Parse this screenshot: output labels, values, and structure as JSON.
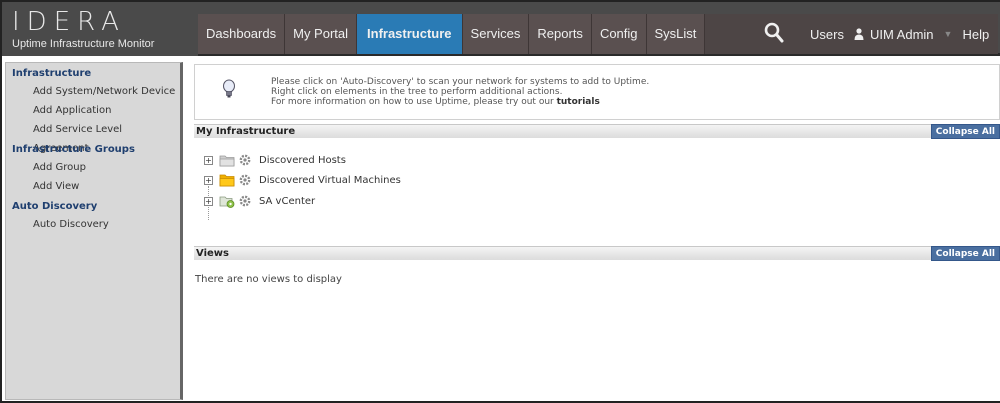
{
  "brand": {
    "logo": "IDERA",
    "subtitle": "Uptime Infrastructure Monitor"
  },
  "nav": {
    "items": [
      {
        "label": "Dashboards",
        "active": false
      },
      {
        "label": "My Portal",
        "active": false
      },
      {
        "label": "Infrastructure",
        "active": true
      },
      {
        "label": "Services",
        "active": false
      },
      {
        "label": "Reports",
        "active": false
      },
      {
        "label": "Config",
        "active": false
      },
      {
        "label": "SysList",
        "active": false
      }
    ],
    "users_label": "Users",
    "user_name": "UIM Admin",
    "help_label": "Help",
    "accent": "#2a7bb5"
  },
  "sidebar": {
    "groups": [
      {
        "title": "Infrastructure",
        "items": [
          "Add System/Network Device",
          "Add Application",
          "Add Service Level Agreement"
        ]
      },
      {
        "title": "Infrastructure Groups",
        "items": [
          "Add Group",
          "Add View"
        ]
      },
      {
        "title": "Auto Discovery",
        "items": [
          "Auto Discovery"
        ]
      }
    ]
  },
  "info": {
    "line1": "Please click on 'Auto-Discovery' to scan your network for systems to add to Uptime.",
    "line2": "Right click on elements in the tree to perform additional actions.",
    "line3_prefix": "For more information on how to use Uptime, please try out our ",
    "line3_link": "tutorials"
  },
  "infrastructure": {
    "title": "My Infrastructure",
    "collapse_label": "Collapse All",
    "tree": [
      {
        "label": "Discovered Hosts",
        "icon": "folder-grey-icon"
      },
      {
        "label": "Discovered Virtual Machines",
        "icon": "folder-yellow-icon"
      },
      {
        "label": "SA vCenter",
        "icon": "vcenter-folder-icon"
      }
    ]
  },
  "views": {
    "title": "Views",
    "collapse_label": "Collapse All",
    "empty_message": "There are no views to display"
  }
}
